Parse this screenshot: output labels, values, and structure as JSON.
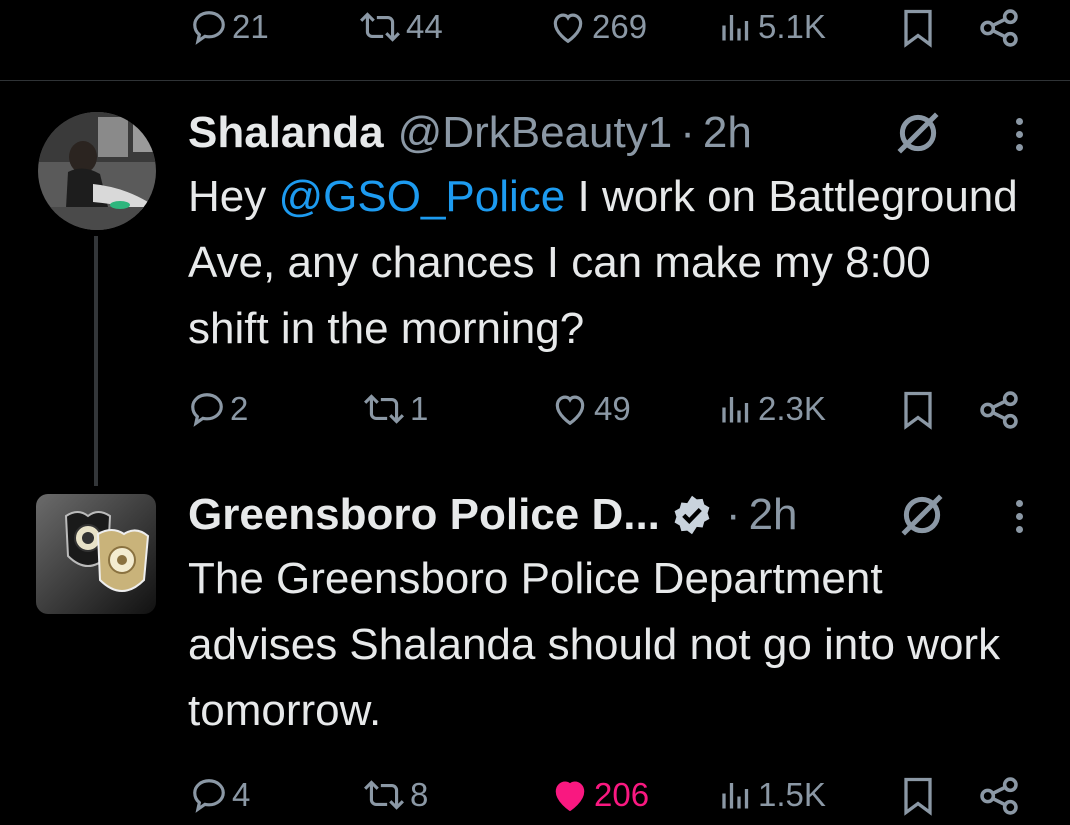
{
  "top_actions": {
    "replies": "21",
    "reposts": "44",
    "likes": "269",
    "views": "5.1K"
  },
  "tweet1": {
    "name": "Shalanda",
    "handle": "@DrkBeauty1",
    "dot": "·",
    "time": "2h",
    "text_before": "Hey ",
    "mention": "@GSO_Police",
    "text_after": " I work on Battleground Ave, any chances I can make my 8:00 shift in the morning?",
    "replies": "2",
    "reposts": "1",
    "likes": "49",
    "views": "2.3K"
  },
  "tweet2": {
    "name": "Greensboro Police D...",
    "dot": "·",
    "time": "2h",
    "text": "The Greensboro Police Department advises Shalanda should not go into work tomorrow.",
    "replies": "4",
    "reposts": "8",
    "likes": "206",
    "views": "1.5K"
  },
  "colors": {
    "background": "#000000",
    "muted": "#8b98a5",
    "mention": "#1d9bf0",
    "like_active": "#f91880",
    "verified": "#1d9bf0"
  }
}
